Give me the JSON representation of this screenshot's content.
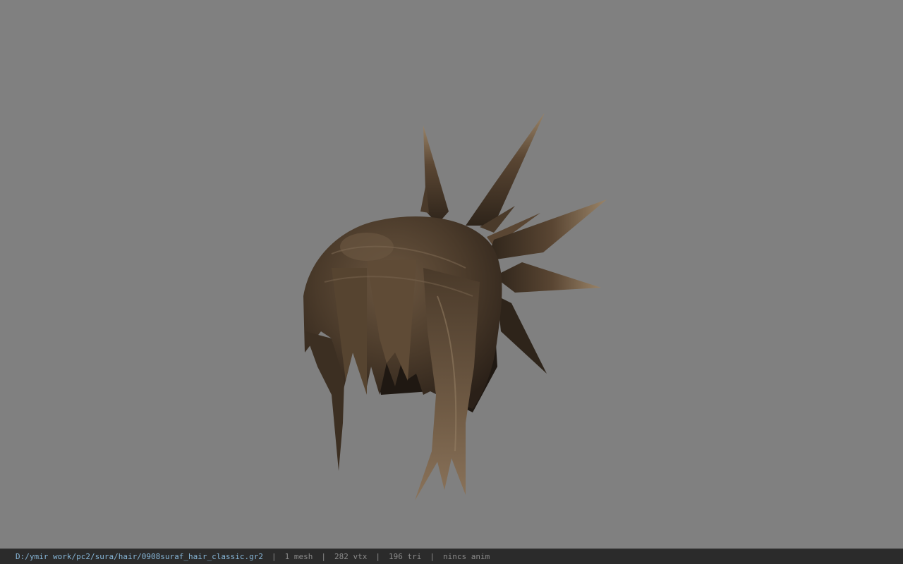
{
  "viewer": {
    "background_color": "#808080",
    "model_colors": {
      "hair_dark": "#2e241a",
      "hair_mid": "#5a4633",
      "hair_light": "#8a735a"
    }
  },
  "status_bar": {
    "file_path": "D:/ymir work/pc2/sura/hair/0908suraf_hair_classic.gr2",
    "separator": "|",
    "mesh_count": "1 mesh",
    "vertex_count": "282 vtx",
    "triangle_count": "196 tri",
    "anim_status": "nincs anim"
  }
}
